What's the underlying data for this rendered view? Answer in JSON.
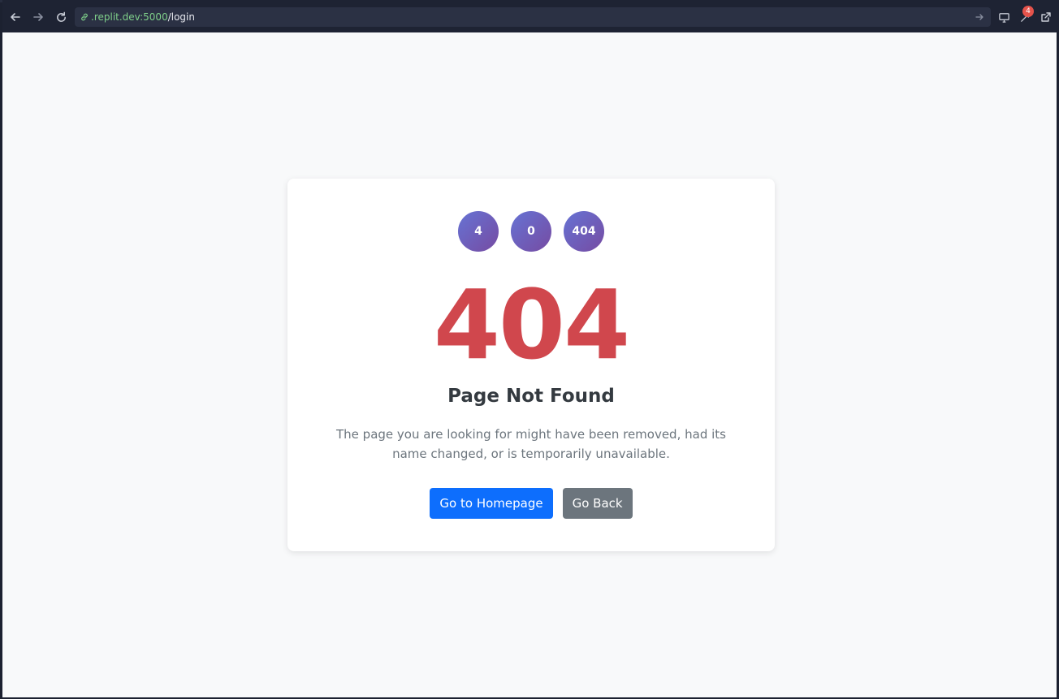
{
  "browser": {
    "url_host": ".replit.dev:5000",
    "url_path": "/login",
    "notification_count": "4",
    "icons": [
      "back-arrow-icon",
      "forward-arrow-icon",
      "reload-icon",
      "link-icon",
      "go-arrow-icon",
      "monitor-icon",
      "wrench-icon",
      "external-link-icon"
    ]
  },
  "error_page": {
    "circles": [
      "4",
      "0",
      "404"
    ],
    "code": "404",
    "title": "Page Not Found",
    "description": "The page you are looking for might have been removed, had its name changed, or is temporarily unavailable.",
    "primary_button": "Go to Homepage",
    "secondary_button": "Go Back"
  },
  "colors": {
    "code_red": "#d0474d",
    "primary_blue": "#0d6efd",
    "secondary_gray": "#6c757d",
    "circle_gradient_start": "#6673d4",
    "circle_gradient_end": "#764ba2",
    "url_host_green": "#7fd08a"
  }
}
